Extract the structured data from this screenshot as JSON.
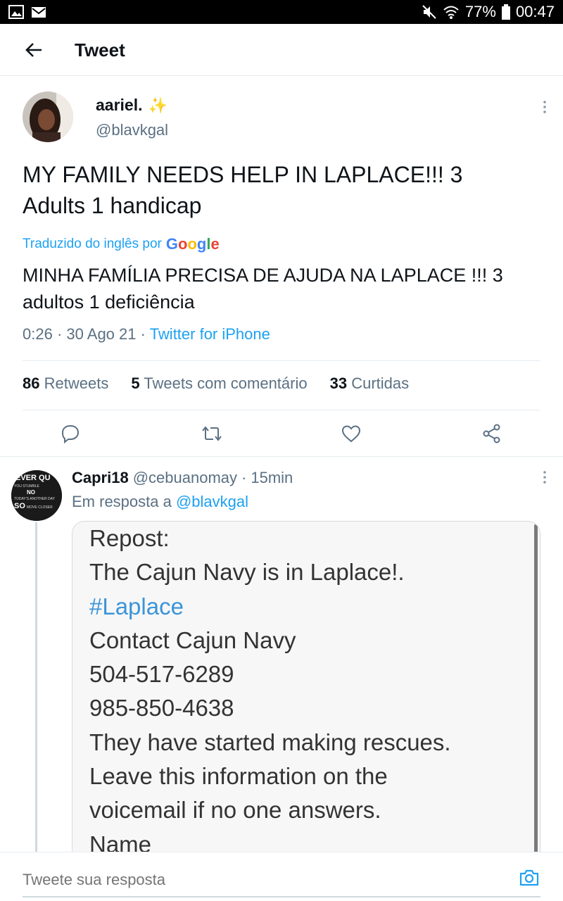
{
  "status_bar": {
    "battery": "77%",
    "time": "00:47",
    "icons": [
      "gallery-icon",
      "mail-icon",
      "mute-icon",
      "wifi-icon",
      "battery-icon"
    ]
  },
  "header": {
    "title": "Tweet"
  },
  "tweet": {
    "display_name": "aariel.",
    "name_emoji": "✨",
    "username": "@blavkgal",
    "text_line1": "MY FAMILY NEEDS HELP IN LAPLACE!!! 3",
    "text_line2": "Adults 1 handicap",
    "translated_label": "Traduzido do inglês por",
    "google": [
      "G",
      "o",
      "o",
      "g",
      "l",
      "e"
    ],
    "translation_line1": "MINHA FAMÍLIA PRECISA DE AJUDA NA LAPLACE !!! 3",
    "translation_line2": "adultos 1 deficiência",
    "time": "0:26",
    "date": "30 Ago 21",
    "source": "Twitter for iPhone",
    "stats": {
      "retweets_count": "86",
      "retweets_label": "Retweets",
      "quotes_count": "5",
      "quotes_label": "Tweets com comentário",
      "likes_count": "33",
      "likes_label": "Curtidas"
    }
  },
  "reply": {
    "display_name": "Capri18",
    "username": "@cebuanomay",
    "time": "15min",
    "reply_to_label": "Em resposta a",
    "reply_to_handle": "@blavkgal",
    "image_text": [
      "Repost:",
      "The Cajun Navy is in Laplace!.",
      "#Laplace",
      "Contact Cajun Navy",
      "504-517-6289",
      "985-850-4638",
      "They have started making rescues.",
      "Leave this information on the",
      "voicemail if no one answers.",
      "Name"
    ],
    "avatar_text": [
      "EVER QU",
      "YOU STUMBLE",
      "NO",
      "TODAY'S ANOTHER DAY",
      "SO",
      "MOVE CLOSER"
    ]
  },
  "compose": {
    "placeholder": "Tweete sua resposta"
  },
  "colors": {
    "accent": "#1da1f2",
    "text_primary": "#0f1419",
    "text_secondary": "#5b7083",
    "border": "#e6ecf0"
  }
}
